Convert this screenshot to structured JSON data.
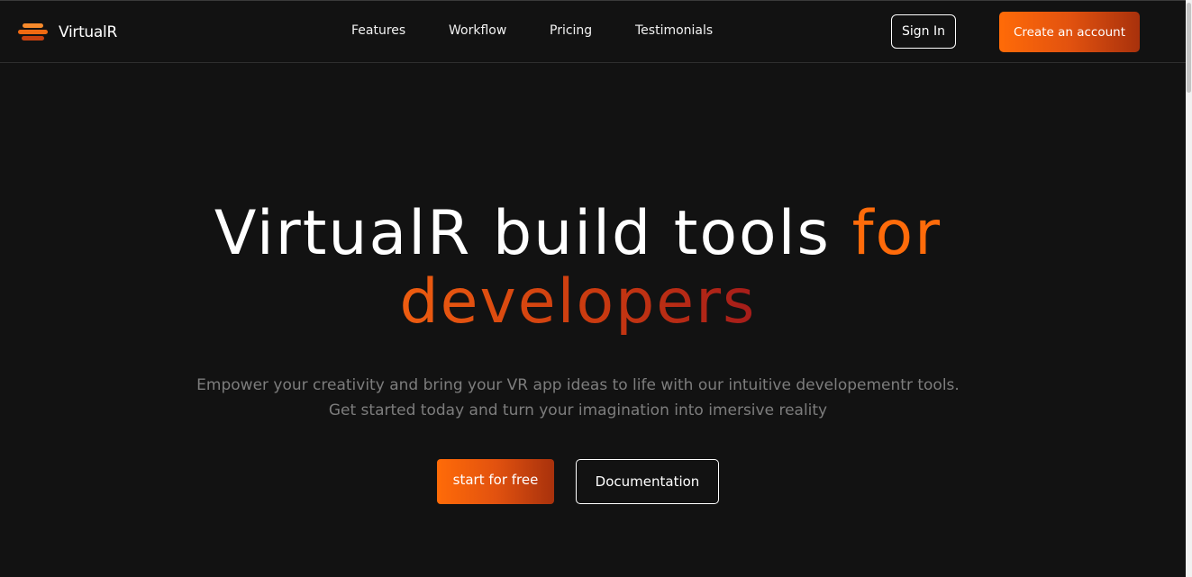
{
  "brand": {
    "logo_icon": "layered-bars-logo-icon",
    "name": "VirtualR"
  },
  "nav": {
    "links": [
      "Features",
      "Workflow",
      "Pricing",
      "Testimonials"
    ],
    "sign_in_label": "Sign In",
    "create_account_label": "Create an account"
  },
  "hero": {
    "title_part1": "VirtualR build tools ",
    "title_part2": "for",
    "title_part3": "developers",
    "subtitle_line1": "Empower your creativity and bring your VR app ideas to life with our intuitive developementr tools.",
    "subtitle_line2": "Get started today and turn your imagination into imersive reality",
    "primary_cta_label": "start for free",
    "secondary_cta_label": "Documentation"
  },
  "colors": {
    "background": "#121212",
    "accent_orange": "#ff6b0a",
    "accent_dark": "#a8310c",
    "subtitle_gray": "#7d7d7d"
  }
}
